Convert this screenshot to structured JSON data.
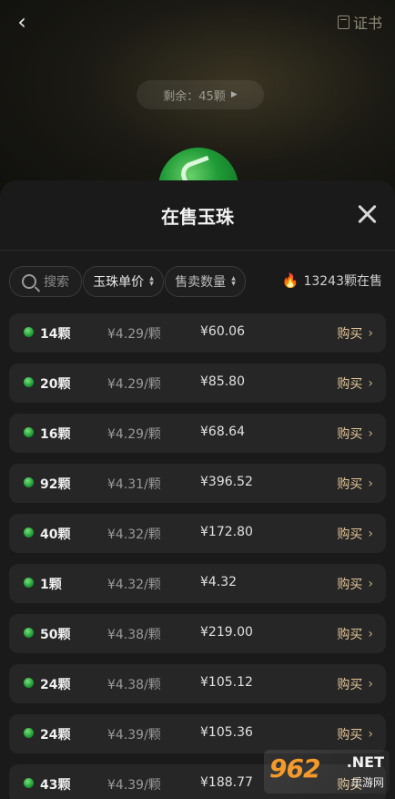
{
  "header": {
    "back_icon": "chevron-left-icon",
    "cert_label": "证书",
    "cert_icon": "document-icon"
  },
  "remain": {
    "text": "剩余：45颗"
  },
  "sheet": {
    "title": "在售玉珠",
    "close_icon": "close-icon"
  },
  "filters": {
    "search_placeholder": "搜索",
    "price_sort": "玉珠单价",
    "qty_sort": "售卖数量",
    "on_sale_text": "13243颗在售"
  },
  "listings": [
    {
      "qty": "14颗",
      "unit": "¥4.29/颗",
      "total": "¥60.06",
      "action": "购买"
    },
    {
      "qty": "20颗",
      "unit": "¥4.29/颗",
      "total": "¥85.80",
      "action": "购买"
    },
    {
      "qty": "16颗",
      "unit": "¥4.29/颗",
      "total": "¥68.64",
      "action": "购买"
    },
    {
      "qty": "92颗",
      "unit": "¥4.31/颗",
      "total": "¥396.52",
      "action": "购买"
    },
    {
      "qty": "40颗",
      "unit": "¥4.32/颗",
      "total": "¥172.80",
      "action": "购买"
    },
    {
      "qty": "1颗",
      "unit": "¥4.32/颗",
      "total": "¥4.32",
      "action": "购买"
    },
    {
      "qty": "50颗",
      "unit": "¥4.38/颗",
      "total": "¥219.00",
      "action": "购买"
    },
    {
      "qty": "24颗",
      "unit": "¥4.38/颗",
      "total": "¥105.12",
      "action": "购买"
    },
    {
      "qty": "24颗",
      "unit": "¥4.39/颗",
      "total": "¥105.36",
      "action": "购买"
    },
    {
      "qty": "43颗",
      "unit": "¥4.39/颗",
      "total": "¥188.77",
      "action": "购买"
    }
  ],
  "watermark": {
    "logo": "962",
    "net": ".NET",
    "site": "乐游网"
  },
  "colors": {
    "accent_gold": "#e2c596",
    "jade_green": "#25a33c",
    "sheet_bg": "#1a1a1a",
    "row_bg": "#262626"
  }
}
